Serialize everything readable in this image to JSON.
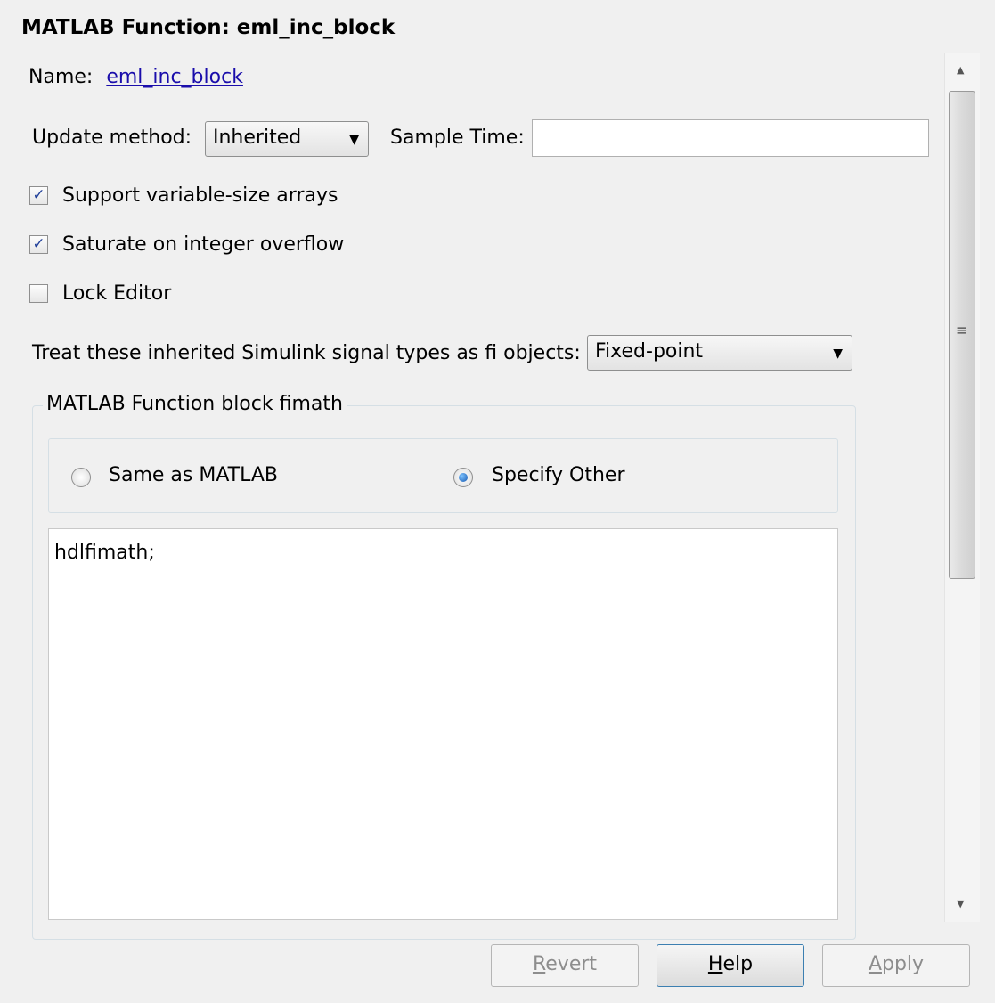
{
  "header": {
    "title": "MATLAB Function: eml_inc_block"
  },
  "name_row": {
    "label": "Name:",
    "link": "eml_inc_block"
  },
  "update_row": {
    "label": "Update method:",
    "method_value": "Inherited",
    "sample_time_label": "Sample Time:",
    "sample_time_value": ""
  },
  "checkboxes": [
    {
      "label": "Support variable-size arrays",
      "checked": true
    },
    {
      "label": "Saturate on integer overflow",
      "checked": true
    },
    {
      "label": "Lock Editor",
      "checked": false
    }
  ],
  "treat_row": {
    "label": "Treat these inherited Simulink signal types as fi objects:",
    "value": "Fixed-point"
  },
  "fimath_group": {
    "legend": "MATLAB Function block fimath",
    "radio_same": {
      "label": "Same as MATLAB",
      "selected": false
    },
    "radio_other": {
      "label": "Specify Other",
      "selected": true
    },
    "editor_text": "hdlfimath;"
  },
  "scrollbar": {
    "up_arrow": "▲",
    "grip": "≡",
    "down_arrow": "▼"
  },
  "buttons": {
    "revert": {
      "first": "R",
      "rest": "evert",
      "enabled": false
    },
    "help": {
      "first": "H",
      "rest": "elp",
      "enabled": true
    },
    "apply": {
      "first": "A",
      "rest": "pply",
      "enabled": false
    }
  },
  "glyphs": {
    "check": "✓",
    "dropdown": "▼"
  }
}
